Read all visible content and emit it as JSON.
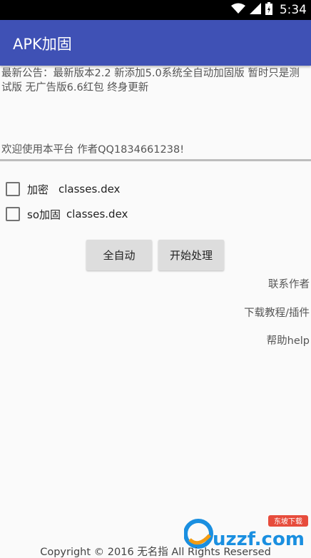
{
  "status_bar": {
    "time": "5:34",
    "icons": [
      "wifi-icon",
      "signal-icon",
      "battery-charging-icon"
    ]
  },
  "app_bar": {
    "title": "APK加固"
  },
  "notice": {
    "text": "最新公告：最新版本2.2 新添加5.0系统全自动加固版 暂时只是测试版 无广告版6.6红包 终身更新"
  },
  "welcome": {
    "text": "欢迎使用本平台 作者QQ1834661238!"
  },
  "options": [
    {
      "label": "加密",
      "file": "classes.dex",
      "checked": false
    },
    {
      "label": "so加固",
      "file": "classes.dex",
      "checked": false
    }
  ],
  "buttons": {
    "auto": "全自动",
    "start": "开始处理"
  },
  "links": {
    "contact": "联系作者",
    "download": "下载教程/插件",
    "help": "帮助help"
  },
  "footer": {
    "copyright": "Copyright © 2016 无名指 All Rights Resersed"
  },
  "watermark": {
    "brand": "uzzf.com",
    "tag": "东坡下载"
  },
  "colors": {
    "app_bar": "#3f51b5",
    "status_bar": "#000000",
    "background": "#fafafa",
    "button": "#dddddd"
  }
}
